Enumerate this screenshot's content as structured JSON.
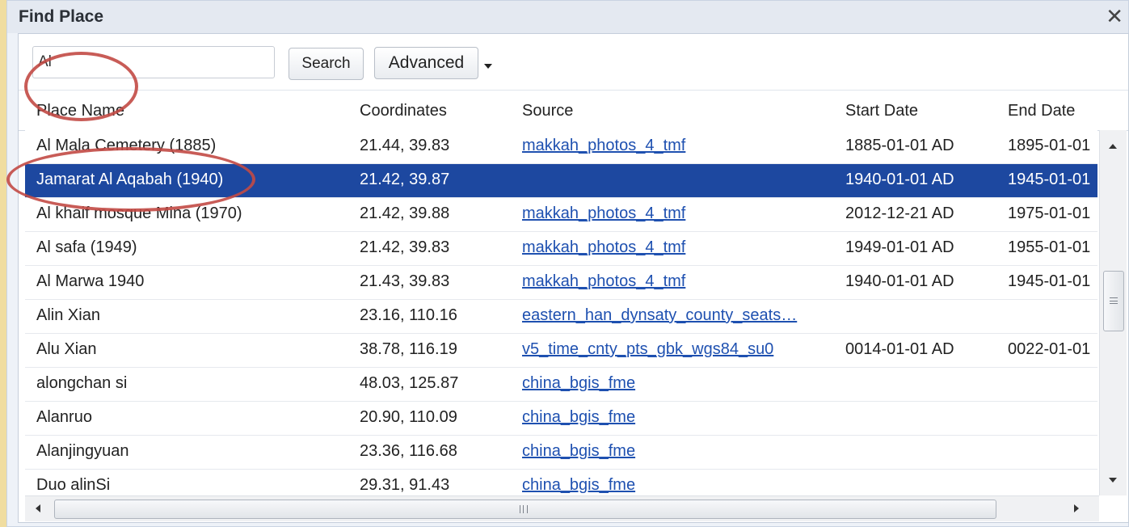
{
  "dialog": {
    "title": "Find Place",
    "close_label": "✕"
  },
  "toolbar": {
    "search_value": "Al",
    "search_label": "Search",
    "advanced_label": "Advanced"
  },
  "columns": [
    "Place Name",
    "Coordinates",
    "Source",
    "Start Date",
    "End Date"
  ],
  "rows": [
    {
      "name": "Al Mala Cemetery (1885)",
      "coord": "21.44, 39.83",
      "source": "makkah_photos_4_tmf",
      "start": "1885-01-01 AD",
      "end": "1895-01-01"
    },
    {
      "name": "Jamarat Al Aqabah (1940)",
      "coord": "21.42, 39.87",
      "source": "",
      "start": "1940-01-01 AD",
      "end": "1945-01-01",
      "selected": true
    },
    {
      "name": "Al khaif mosque Mina (1970)",
      "coord": "21.42, 39.88",
      "source": "makkah_photos_4_tmf",
      "start": "2012-12-21 AD",
      "end": "1975-01-01"
    },
    {
      "name": "Al safa (1949)",
      "coord": "21.42, 39.83",
      "source": "makkah_photos_4_tmf",
      "start": "1949-01-01 AD",
      "end": "1955-01-01"
    },
    {
      "name": "Al Marwa 1940",
      "coord": "21.43, 39.83",
      "source": "makkah_photos_4_tmf",
      "start": "1940-01-01 AD",
      "end": "1945-01-01"
    },
    {
      "name": "Alin Xian",
      "coord": "23.16, 110.16",
      "source": "eastern_han_dynsaty_county_seats…",
      "start": "",
      "end": ""
    },
    {
      "name": "Alu Xian",
      "coord": "38.78, 116.19",
      "source": "v5_time_cnty_pts_gbk_wgs84_su0",
      "start": "0014-01-01 AD",
      "end": "0022-01-01"
    },
    {
      "name": "alongchan si",
      "coord": "48.03, 125.87",
      "source": "china_bgis_fme",
      "start": "",
      "end": ""
    },
    {
      "name": "Alanruo",
      "coord": "20.90, 110.09",
      "source": "china_bgis_fme",
      "start": "",
      "end": ""
    },
    {
      "name": "Alanjingyuan",
      "coord": "23.36, 116.68",
      "source": "china_bgis_fme",
      "start": "",
      "end": ""
    },
    {
      "name": "Duo alinSi",
      "coord": "29.31, 91.43",
      "source": "china_bgis_fme",
      "start": "",
      "end": ""
    }
  ],
  "colors": {
    "selected_row": "#1d48a0",
    "link": "#1e50b0",
    "annotation": "#c24a45",
    "background": "#f0dda0"
  },
  "icons": {
    "close": "close-icon",
    "dropdown": "caret-down-icon",
    "scroll_up": "arrow-up-icon",
    "scroll_down": "arrow-down-icon",
    "scroll_left": "arrow-left-icon",
    "scroll_right": "arrow-right-icon"
  }
}
